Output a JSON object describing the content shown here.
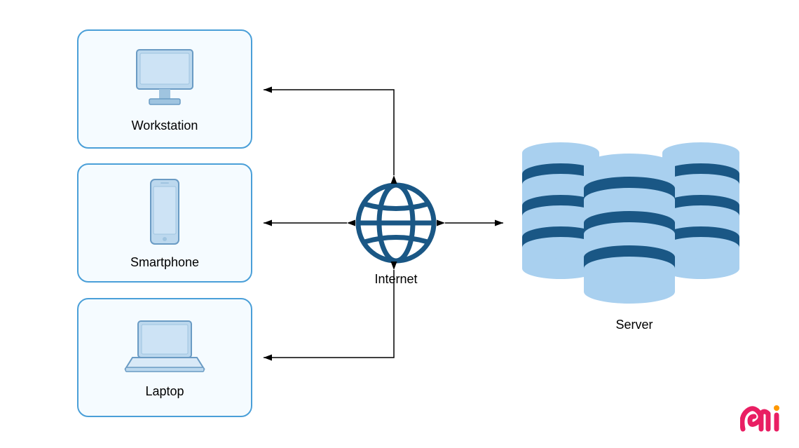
{
  "clients": [
    {
      "id": "workstation",
      "label": "Workstation"
    },
    {
      "id": "smartphone",
      "label": "Smartphone"
    },
    {
      "id": "laptop",
      "label": "Laptop"
    }
  ],
  "hub": {
    "label": "Internet"
  },
  "server": {
    "label": "Server"
  },
  "colors": {
    "card_border": "#4a9fd8",
    "card_bg": "#f5fbff",
    "globe": "#1a5785",
    "arrow": "#000000",
    "db_light": "#a9d0ef",
    "db_dark": "#1a5785",
    "device_fill": "#bcd8ee",
    "device_stroke": "#6a9bc4"
  }
}
